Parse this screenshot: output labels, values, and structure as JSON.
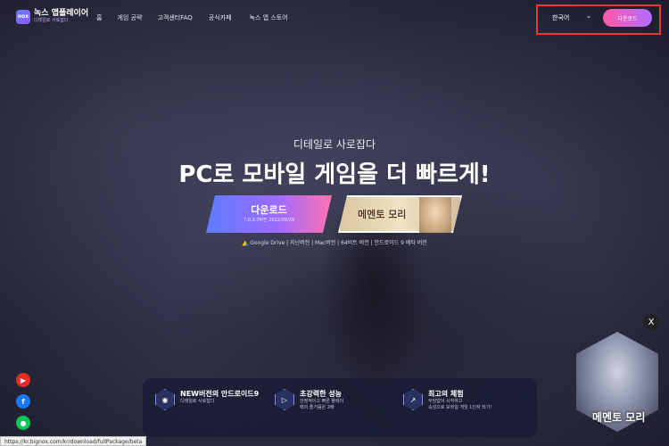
{
  "header": {
    "logo_icon": "nox",
    "logo_name": "녹스 앱플레이어",
    "logo_sub": "디테일로 사로잡다",
    "nav": [
      {
        "label": "홈"
      },
      {
        "label": "게임 공략"
      },
      {
        "label": "고객센터FAQ"
      },
      {
        "label": "공식카페"
      },
      {
        "label": "녹스 앱 스토어"
      }
    ],
    "language": "한국어",
    "download_label": "다운로드"
  },
  "hero": {
    "tagline": "디테일로 사로잡다",
    "headline": "PC로 모바일 게임을 더 빠르게!",
    "download_label": "다운로드",
    "version_text": "7.0.3.7버전 2022/09/29",
    "game_title": "메멘토 모리",
    "links": [
      "Google Drive",
      "지난버전",
      "Mac버전",
      "64비트 버전",
      "안드로이드 9 베타 버전"
    ]
  },
  "features": [
    {
      "icon": "android-icon",
      "title": "NEW버전의 안드로이드9",
      "desc": [
        "디테일로 사로잡다"
      ]
    },
    {
      "icon": "play-icon",
      "title": "초강력한 성능",
      "desc": [
        "안정적이고 빠른 플레이",
        "렉의 즐거움은 2배"
      ]
    },
    {
      "icon": "chart-icon",
      "title": "최고의 체험",
      "desc": [
        "부담없이 시작하고",
        "속성으로 모바일 게임 1인자 되기!"
      ]
    }
  ],
  "ad": {
    "caption": "메멘토 모리",
    "close": "X"
  },
  "status_bar": "https://kr.bignox.com/kr/download/fullPackage/beta",
  "colors": {
    "accent_pink": "#ff5aa8",
    "accent_purple": "#9b6bff",
    "highlight": "#e53935"
  }
}
